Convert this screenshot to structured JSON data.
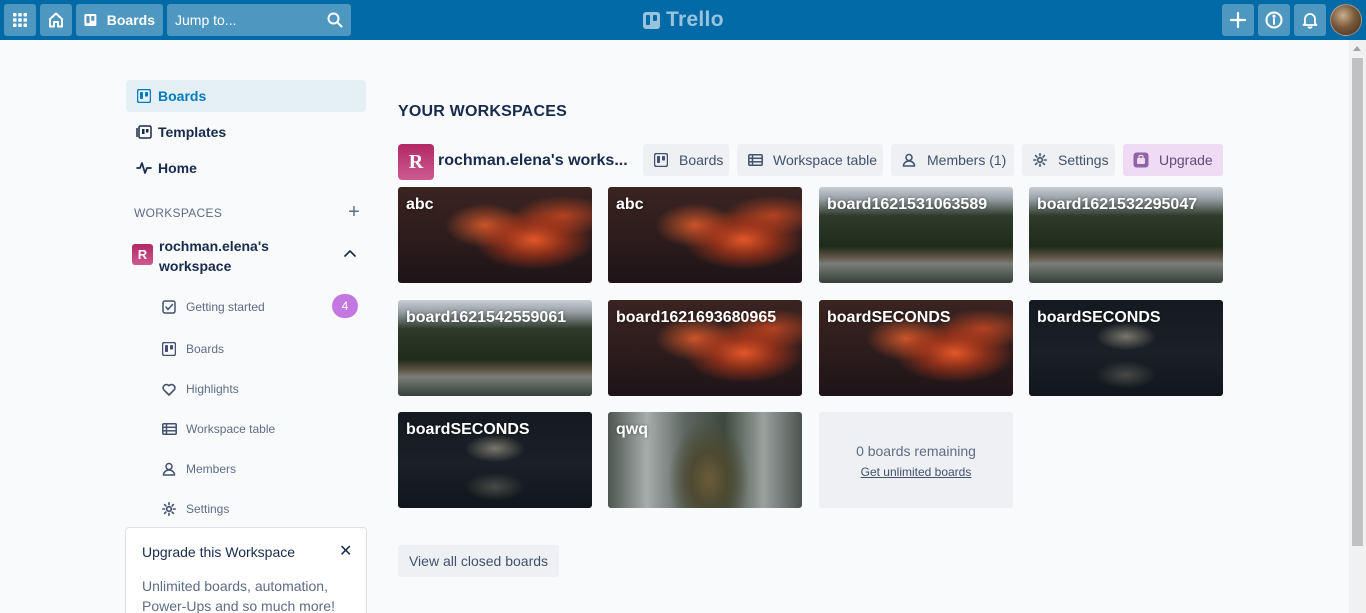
{
  "header": {
    "boards_label": "Boards",
    "search_placeholder": "Jump to...",
    "logo_text": "Trello",
    "bg_color": "#026aa7"
  },
  "sidebar": {
    "nav": [
      {
        "label": "Boards",
        "icon": "board-icon",
        "active": true
      },
      {
        "label": "Templates",
        "icon": "template-icon"
      },
      {
        "label": "Home",
        "icon": "activity-icon"
      }
    ],
    "workspaces_label": "WORKSPACES",
    "workspace": {
      "initial": "R",
      "name": "rochman.elena's workspace",
      "items": [
        {
          "label": "Getting started",
          "icon": "checkbox-icon",
          "badge": "4"
        },
        {
          "label": "Boards",
          "icon": "board-icon"
        },
        {
          "label": "Highlights",
          "icon": "heart-icon"
        },
        {
          "label": "Workspace table",
          "icon": "table-icon"
        },
        {
          "label": "Members",
          "icon": "members-icon"
        },
        {
          "label": "Settings",
          "icon": "gear-icon"
        }
      ]
    },
    "upgrade_card": {
      "title": "Upgrade this Workspace",
      "description": "Unlimited boards, automation, Power-Ups and so much more!"
    }
  },
  "main": {
    "section_title": "YOUR WORKSPACES",
    "workspace_initial": "R",
    "workspace_name": "rochman.elena's works...",
    "tabs": [
      {
        "label": "Boards",
        "icon": "board-icon"
      },
      {
        "label": "Workspace table",
        "icon": "table-icon"
      },
      {
        "label": "Members (1)",
        "icon": "members-icon"
      },
      {
        "label": "Settings",
        "icon": "gear-icon"
      },
      {
        "label": "Upgrade",
        "icon": "upgrade-icon"
      }
    ],
    "boards": [
      {
        "name": "abc",
        "background": "clouds"
      },
      {
        "name": "abc",
        "background": "clouds"
      },
      {
        "name": "board1621531063589",
        "background": "forest"
      },
      {
        "name": "board1621532295047",
        "background": "forest"
      },
      {
        "name": "board1621542559061",
        "background": "forest"
      },
      {
        "name": "board1621693680965",
        "background": "clouds"
      },
      {
        "name": "boardSECONDS",
        "background": "clouds"
      },
      {
        "name": "boardSECONDS",
        "background": "house"
      },
      {
        "name": "boardSECONDS",
        "background": "house"
      },
      {
        "name": "qwq",
        "background": "tree"
      }
    ],
    "remaining": {
      "count_text": "0 boards remaining",
      "link_text": "Get unlimited boards"
    },
    "closed_boards_label": "View all closed boards"
  }
}
